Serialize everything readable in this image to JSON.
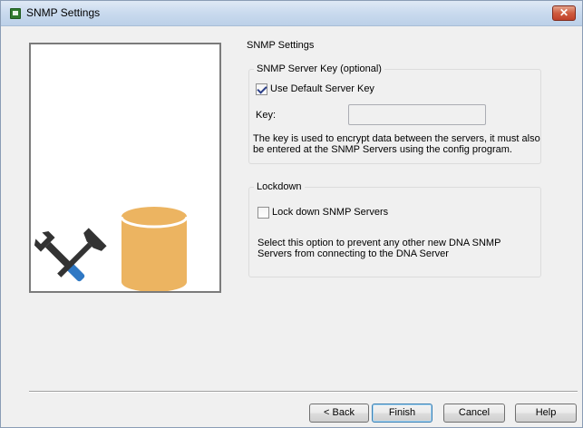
{
  "window": {
    "title": "SNMP Settings",
    "close_label": "✕"
  },
  "section_title": "SNMP Settings",
  "server_key_group": {
    "legend": "SNMP Server Key (optional)",
    "use_default_label": "Use Default Server Key",
    "use_default_checked": true,
    "key_label": "Key:",
    "key_value": "",
    "description": "The key is used to encrypt data between the servers, it must also be entered at the SNMP Servers using the config program."
  },
  "lockdown_group": {
    "legend": "Lockdown",
    "lock_label": "Lock down SNMP Servers",
    "lock_checked": false,
    "description": "Select this option to prevent any other new DNA SNMP Servers from connecting to the DNA Server"
  },
  "buttons": {
    "back": "< Back",
    "finish": "Finish",
    "cancel": "Cancel",
    "help": "Help"
  },
  "art": {
    "tools_icon": "wrench-hammer-icon",
    "database_icon": "database-cylinder-icon",
    "database_color": "#ecb461",
    "tool_color": "#333333",
    "handle_color": "#2f78c4"
  }
}
